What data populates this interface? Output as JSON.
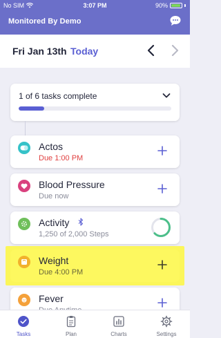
{
  "status_bar": {
    "carrier": "No SIM",
    "time": "3:07 PM",
    "battery": "90%",
    "battery_level": 0.9
  },
  "header": {
    "title": "Monitored By Demo",
    "chat_icon": "chat-bubble-icon"
  },
  "date_bar": {
    "date": "Fri Jan 13th",
    "today_label": "Today"
  },
  "progress": {
    "label": "1 of 6 tasks complete",
    "completed": 1,
    "total": 6
  },
  "tasks": [
    {
      "name": "Actos",
      "subtitle": "Due 1:00 PM",
      "icon": "pill-icon",
      "icon_color": "#35c2c8",
      "overdue": true
    },
    {
      "name": "Blood Pressure",
      "subtitle": "Due now",
      "icon": "heart-icon",
      "icon_color": "#d9417e"
    },
    {
      "name": "Activity",
      "subtitle": "1,250 of 2,000 Steps",
      "icon": "activity-icon",
      "icon_color": "#6fbf5a",
      "steps_done": 1250,
      "steps_goal": 2000
    },
    {
      "name": "Weight",
      "subtitle": "Due 4:00 PM",
      "icon": "scale-icon",
      "icon_color": "#f2b12c",
      "highlighted": true
    },
    {
      "name": "Fever",
      "subtitle": "Due Anytime",
      "icon": "thermometer-icon",
      "icon_color": "#f4a13a"
    }
  ],
  "tabbar": {
    "items": [
      {
        "label": "Tasks",
        "icon": "check-circle-icon",
        "active": true
      },
      {
        "label": "Plan",
        "icon": "clipboard-icon"
      },
      {
        "label": "Charts",
        "icon": "chart-icon"
      },
      {
        "label": "Settings",
        "icon": "gear-icon"
      }
    ]
  },
  "colors": {
    "brand": "#6b6fc9",
    "accent": "#5a5fd3",
    "highlight": "#fbf65a",
    "overdue": "#e04040"
  }
}
